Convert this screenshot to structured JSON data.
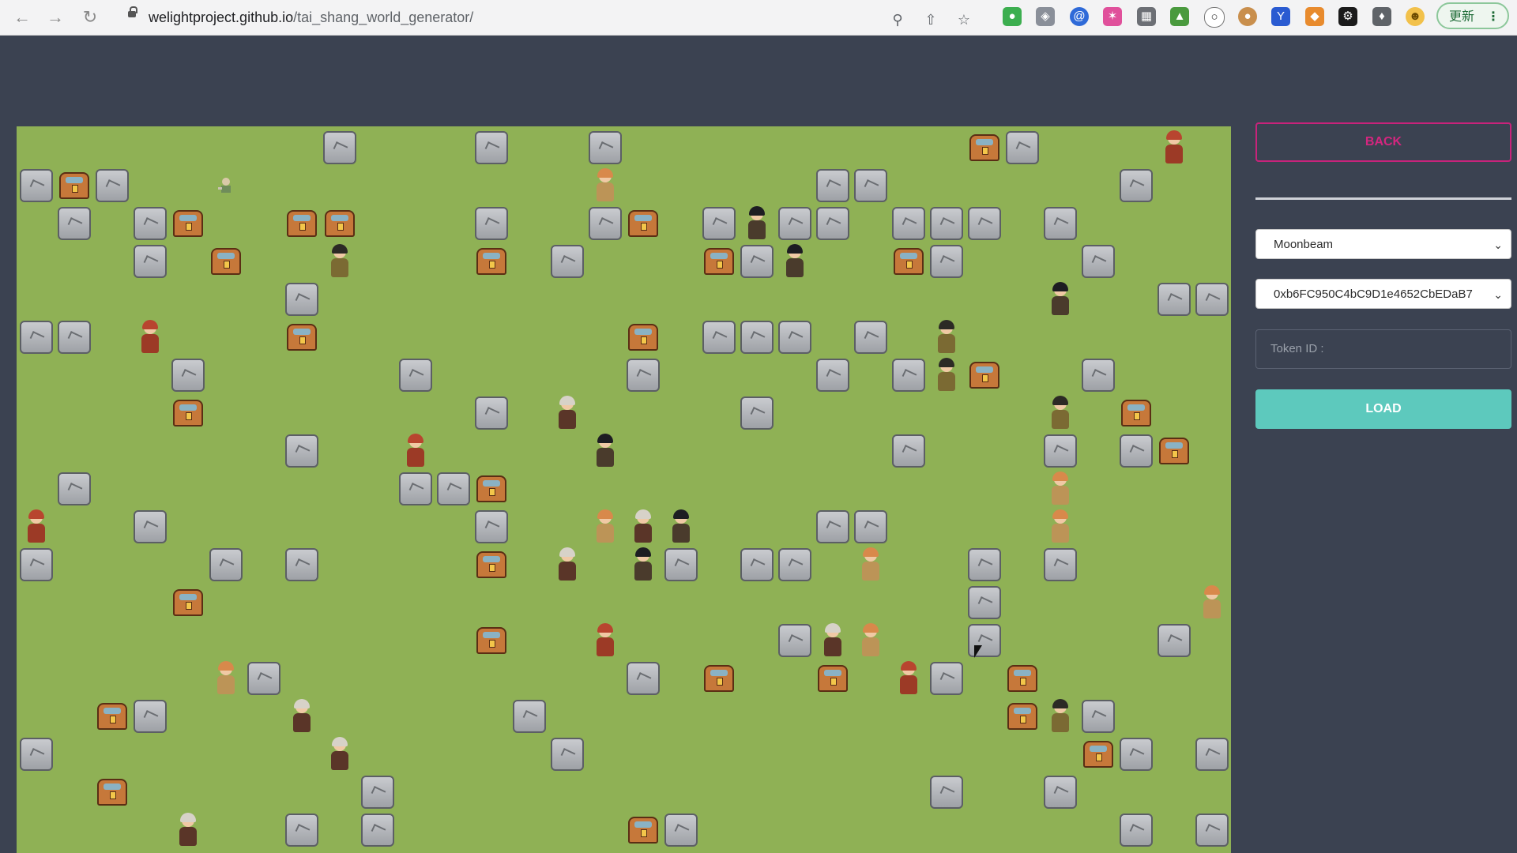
{
  "browser": {
    "url_host": "welightproject.github.io",
    "url_path": "/tai_shang_world_generator/",
    "update_label": "更新",
    "update_menu_glyph": "⋮",
    "nav_icons": [
      "back-arrow-icon",
      "forward-arrow-icon",
      "reload-icon"
    ],
    "url_icons": [
      "zoom-icon",
      "share-icon",
      "bookmark-star-icon"
    ],
    "extension_icons": [
      "evernote-icon",
      "shield-icon",
      "at-sign-icon",
      "sparkle-icon",
      "qr-icon",
      "android-icon",
      "circle-icon",
      "cookie-icon",
      "y-icon",
      "metamask-icon",
      "chatgpt-icon",
      "puzzle-icon",
      "profile-avatar-icon"
    ]
  },
  "panel": {
    "back_label": "BACK",
    "network_select": "Moonbeam",
    "address_select": "0xb6FC950C4bC9D1e4652CbEDaB7",
    "token_placeholder": "Token ID :",
    "load_label": "LOAD"
  },
  "colors": {
    "page_bg": "#3b4251",
    "grass": "#8fb155",
    "back_border": "#c8237b",
    "load_bg": "#5dc9bd"
  },
  "map": {
    "rocks": [
      [
        8,
        0
      ],
      [
        12,
        0
      ],
      [
        15,
        0
      ],
      [
        26,
        0
      ],
      [
        0,
        1
      ],
      [
        2,
        1
      ],
      [
        21,
        1
      ],
      [
        22,
        1
      ],
      [
        29,
        1
      ],
      [
        1,
        2
      ],
      [
        3,
        2
      ],
      [
        12,
        2
      ],
      [
        15,
        2
      ],
      [
        18,
        2
      ],
      [
        20,
        2
      ],
      [
        21,
        2
      ],
      [
        23,
        2
      ],
      [
        24,
        2
      ],
      [
        25,
        2
      ],
      [
        27,
        2
      ],
      [
        3,
        3
      ],
      [
        14,
        3
      ],
      [
        19,
        3
      ],
      [
        24,
        3
      ],
      [
        28,
        3
      ],
      [
        7,
        4
      ],
      [
        30,
        4
      ],
      [
        31,
        4
      ],
      [
        0,
        5
      ],
      [
        1,
        5
      ],
      [
        18,
        5
      ],
      [
        19,
        5
      ],
      [
        20,
        5
      ],
      [
        22,
        5
      ],
      [
        4,
        6
      ],
      [
        10,
        6
      ],
      [
        16,
        6
      ],
      [
        21,
        6
      ],
      [
        23,
        6
      ],
      [
        28,
        6
      ],
      [
        12,
        7
      ],
      [
        19,
        7
      ],
      [
        7,
        8
      ],
      [
        23,
        8
      ],
      [
        27,
        8
      ],
      [
        29,
        8
      ],
      [
        1,
        9
      ],
      [
        10,
        9
      ],
      [
        11,
        9
      ],
      [
        3,
        10
      ],
      [
        12,
        10
      ],
      [
        21,
        10
      ],
      [
        22,
        10
      ],
      [
        0,
        11
      ],
      [
        5,
        11
      ],
      [
        7,
        11
      ],
      [
        17,
        11
      ],
      [
        19,
        11
      ],
      [
        20,
        11
      ],
      [
        25,
        11
      ],
      [
        27,
        11
      ],
      [
        25,
        12
      ],
      [
        20,
        13
      ],
      [
        25,
        13
      ],
      [
        30,
        13
      ],
      [
        6,
        14
      ],
      [
        16,
        14
      ],
      [
        24,
        14
      ],
      [
        3,
        15
      ],
      [
        13,
        15
      ],
      [
        28,
        15
      ],
      [
        0,
        16
      ],
      [
        14,
        16
      ],
      [
        29,
        16
      ],
      [
        31,
        16
      ],
      [
        9,
        17
      ],
      [
        24,
        17
      ],
      [
        27,
        17
      ],
      [
        7,
        18
      ],
      [
        9,
        18
      ],
      [
        17,
        18
      ],
      [
        29,
        18
      ],
      [
        31,
        18
      ]
    ],
    "chests": [
      [
        25,
        0
      ],
      [
        1,
        1
      ],
      [
        4,
        2
      ],
      [
        7,
        2
      ],
      [
        8,
        2
      ],
      [
        16,
        2
      ],
      [
        5,
        3
      ],
      [
        12,
        3
      ],
      [
        18,
        3
      ],
      [
        23,
        3
      ],
      [
        7,
        5
      ],
      [
        16,
        5
      ],
      [
        25,
        6
      ],
      [
        4,
        7
      ],
      [
        29,
        7
      ],
      [
        30,
        8
      ],
      [
        12,
        9
      ],
      [
        12,
        11
      ],
      [
        4,
        12
      ],
      [
        12,
        13
      ],
      [
        18,
        14
      ],
      [
        21,
        14
      ],
      [
        26,
        14
      ],
      [
        2,
        15
      ],
      [
        26,
        15
      ],
      [
        28,
        16
      ],
      [
        2,
        17
      ],
      [
        16,
        18
      ]
    ],
    "characters": [
      {
        "cell": [
          30,
          0
        ],
        "kind": "red"
      },
      {
        "cell": [
          15,
          1
        ],
        "kind": "orange"
      },
      {
        "cell": [
          19,
          2
        ],
        "kind": "dark"
      },
      {
        "cell": [
          8,
          3
        ],
        "kind": "brown"
      },
      {
        "cell": [
          20,
          3
        ],
        "kind": "dark"
      },
      {
        "cell": [
          27,
          4
        ],
        "kind": "dark"
      },
      {
        "cell": [
          3,
          5
        ],
        "kind": "red"
      },
      {
        "cell": [
          24,
          5
        ],
        "kind": "brown"
      },
      {
        "cell": [
          24,
          6
        ],
        "kind": "brown"
      },
      {
        "cell": [
          14,
          7
        ],
        "kind": "bald"
      },
      {
        "cell": [
          27,
          7
        ],
        "kind": "brown"
      },
      {
        "cell": [
          10,
          8
        ],
        "kind": "red"
      },
      {
        "cell": [
          15,
          8
        ],
        "kind": "dark"
      },
      {
        "cell": [
          27,
          9
        ],
        "kind": "orange"
      },
      {
        "cell": [
          0,
          10
        ],
        "kind": "red"
      },
      {
        "cell": [
          15,
          10
        ],
        "kind": "orange"
      },
      {
        "cell": [
          16,
          10
        ],
        "kind": "bald"
      },
      {
        "cell": [
          17,
          10
        ],
        "kind": "dark"
      },
      {
        "cell": [
          27,
          10
        ],
        "kind": "orange"
      },
      {
        "cell": [
          14,
          11
        ],
        "kind": "bald"
      },
      {
        "cell": [
          16,
          11
        ],
        "kind": "dark"
      },
      {
        "cell": [
          22,
          11
        ],
        "kind": "orange"
      },
      {
        "cell": [
          31,
          12
        ],
        "kind": "orange"
      },
      {
        "cell": [
          15,
          13
        ],
        "kind": "red"
      },
      {
        "cell": [
          21,
          13
        ],
        "kind": "bald"
      },
      {
        "cell": [
          22,
          13
        ],
        "kind": "orange"
      },
      {
        "cell": [
          5,
          14
        ],
        "kind": "orange"
      },
      {
        "cell": [
          23,
          14
        ],
        "kind": "red"
      },
      {
        "cell": [
          7,
          15
        ],
        "kind": "bald"
      },
      {
        "cell": [
          27,
          15
        ],
        "kind": "brown"
      },
      {
        "cell": [
          8,
          16
        ],
        "kind": "bald"
      },
      {
        "cell": [
          4,
          18
        ],
        "kind": "bald"
      }
    ],
    "player_sprite_cell": [
      5,
      1
    ]
  }
}
